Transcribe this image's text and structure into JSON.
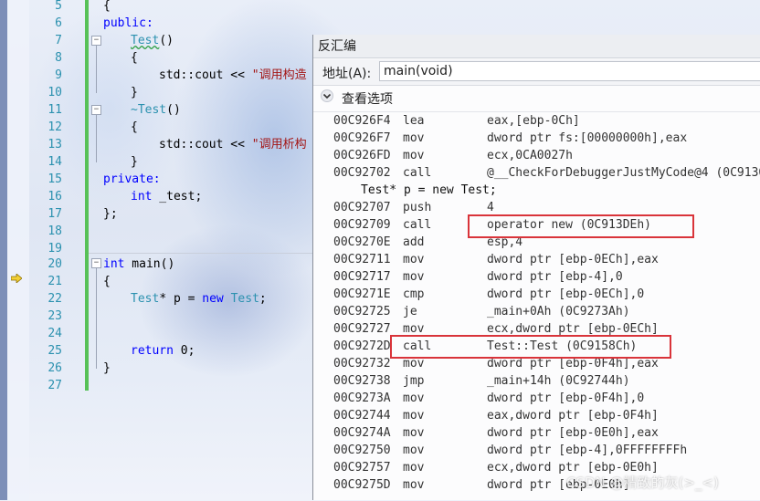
{
  "editor": {
    "line_numbers": [
      "5",
      "6",
      "7",
      "8",
      "9",
      "10",
      "11",
      "12",
      "13",
      "14",
      "15",
      "16",
      "17",
      "18",
      "19",
      "20",
      "21",
      "22",
      "23",
      "24",
      "25",
      "26",
      "27"
    ],
    "lines": {
      "l5": "{",
      "l6_kw": "public:",
      "l7_name": "Test",
      "l7_rest": "()",
      "l8": "{",
      "l9_std": "std::cout << ",
      "l9_str": "\"调用构造",
      "l10": "}",
      "l11_name": "~Test",
      "l11_rest": "()",
      "l12": "{",
      "l13_std": "std::cout << ",
      "l13_str": "\"调用析构",
      "l14": "}",
      "l15_kw": "private:",
      "l16_kw": "int",
      "l16_rest": " _test;",
      "l17": "};",
      "l20_kw": "int",
      "l20_rest": " main()",
      "l21": "{",
      "l22_type": "Test",
      "l22_mid": "* p = ",
      "l22_kw": "new",
      "l22_sp": " ",
      "l22_type2": "Test",
      "l22_end": ";",
      "l25_kw": "return",
      "l25_rest": " 0;",
      "l26": "}"
    }
  },
  "disasm": {
    "title": "反汇编",
    "address_label": "地址(A):",
    "address_value": "main(void)",
    "options_label": "查看选项",
    "rows": [
      {
        "addr": "00C926F4",
        "mn": "lea",
        "op": "eax,[ebp-0Ch]"
      },
      {
        "addr": "00C926F7",
        "mn": "mov",
        "op": "dword ptr fs:[00000000h],eax"
      },
      {
        "addr": "00C926FD",
        "mn": "mov",
        "op": "ecx,0CA0027h"
      },
      {
        "addr": "00C92702",
        "mn": "call",
        "op": "@__CheckForDebuggerJustMyCode@4 (0C9130"
      },
      {
        "src": "Test* p = new Test;"
      },
      {
        "addr": "00C92707",
        "mn": "push",
        "op": "4"
      },
      {
        "addr": "00C92709",
        "mn": "call",
        "op": "operator new (0C913DEh)"
      },
      {
        "addr": "00C9270E",
        "mn": "add",
        "op": "esp,4"
      },
      {
        "addr": "00C92711",
        "mn": "mov",
        "op": "dword ptr [ebp-0ECh],eax"
      },
      {
        "addr": "00C92717",
        "mn": "mov",
        "op": "dword ptr [ebp-4],0"
      },
      {
        "addr": "00C9271E",
        "mn": "cmp",
        "op": "dword ptr [ebp-0ECh],0"
      },
      {
        "addr": "00C92725",
        "mn": "je",
        "op": "_main+0Ah (0C9273Ah)"
      },
      {
        "addr": "00C92727",
        "mn": "mov",
        "op": "ecx,dword ptr [ebp-0ECh]"
      },
      {
        "addr": "00C9272D",
        "mn": "call",
        "op": "Test::Test (0C9158Ch)"
      },
      {
        "addr": "00C92732",
        "mn": "mov",
        "op": "dword ptr [ebp-0F4h],eax"
      },
      {
        "addr": "00C92738",
        "mn": "jmp",
        "op": "_main+14h (0C92744h)"
      },
      {
        "addr": "00C9273A",
        "mn": "mov",
        "op": "dword ptr [ebp-0F4h],0"
      },
      {
        "addr": "00C92744",
        "mn": "mov",
        "op": "eax,dword ptr [ebp-0F4h]"
      },
      {
        "addr": "00C9274A",
        "mn": "mov",
        "op": "dword ptr [ebp-0E0h],eax"
      },
      {
        "addr": "00C92750",
        "mn": "mov",
        "op": "dword ptr [ebp-4],0FFFFFFFFh"
      },
      {
        "addr": "00C92757",
        "mn": "mov",
        "op": "ecx,dword ptr [ebp-0E0h]"
      },
      {
        "addr": "00C9275D",
        "mn": "mov",
        "op": "dword ptr [ebp-0E0h]"
      }
    ]
  },
  "watermark": "CSDN @精致的灰(>_<)"
}
